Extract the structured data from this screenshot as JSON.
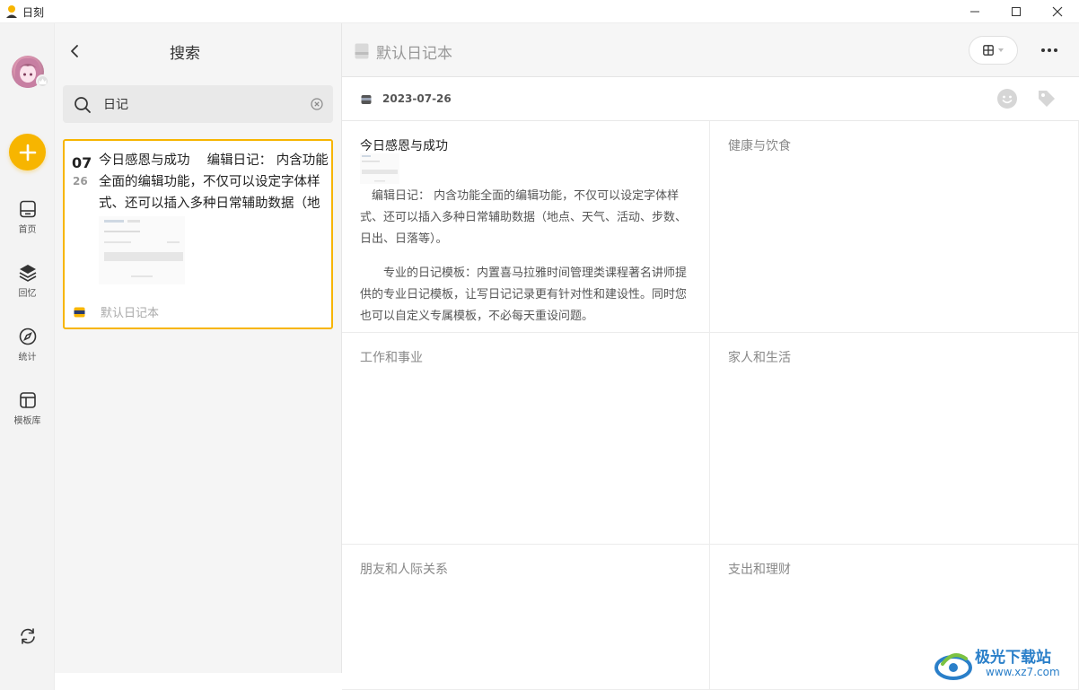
{
  "window": {
    "title": "日刻"
  },
  "sidebar": {
    "items": [
      {
        "label": "首页",
        "icon": "home-icon"
      },
      {
        "label": "回忆",
        "icon": "layers-icon"
      },
      {
        "label": "统计",
        "icon": "compass-icon"
      },
      {
        "label": "模板库",
        "icon": "template-icon"
      }
    ],
    "add_icon": "plus-icon",
    "sync_icon": "sync-icon"
  },
  "search_panel": {
    "title": "搜索",
    "search": {
      "value": "日记",
      "placeholder": ""
    },
    "result": {
      "day": "07",
      "month": "26",
      "text": "今日感恩与成功　 编辑日记： 内含功能全面的编辑功能，不仅可以设定字体样式、还可以插入多种日常辅助数据（地点、天气、活动、步数、日出、日落等）。",
      "notebook": "默认日记本"
    }
  },
  "main": {
    "notebook_title": "默认日记本",
    "date": "2023-07-26",
    "sections": [
      {
        "title": "今日感恩与成功",
        "paragraphs": [
          "　编辑日记： 内含功能全面的编辑功能，不仅可以设定字体样式、还可以插入多种日常辅助数据（地点、天气、活动、步数、日出、日落等）。",
          "　　专业的日记模板：内置喜马拉雅时间管理类课程著名讲师提供的专业日记模板，让写日记记录更有针对性和建设性。同时您也可以自定义专属模板，不必每天重设问题。"
        ]
      },
      {
        "title": "健康与饮食"
      },
      {
        "title": "工作和事业"
      },
      {
        "title": "家人和生活"
      },
      {
        "title": "朋友和人际关系"
      },
      {
        "title": "支出和理财"
      }
    ]
  },
  "watermark": {
    "text": "极光下载站",
    "url": "www.xz7.com"
  },
  "colors": {
    "accent": "#f7b500",
    "rail_bg": "#f3f3f3",
    "panel_bg": "#f5f5f5"
  }
}
